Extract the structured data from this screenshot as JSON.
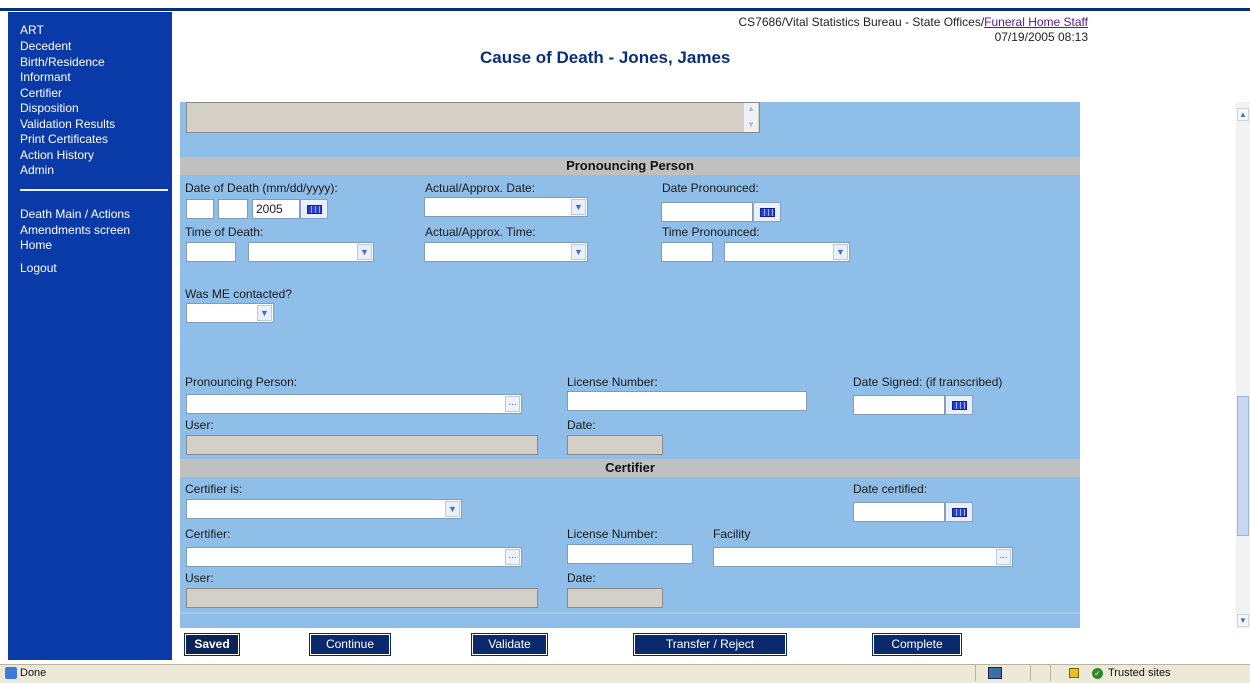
{
  "sidebar": {
    "items": [
      "ART",
      "Decedent",
      "Birth/Residence",
      "Informant",
      "Certifier",
      "Disposition",
      "Validation Results",
      "Print Certificates",
      "Action History",
      "Admin"
    ],
    "links": [
      "Death Main / Actions",
      "Amendments screen",
      "Home"
    ],
    "logout": "Logout"
  },
  "header": {
    "location": "CS7686/Vital Statistics Bureau - State Offices/",
    "role_link": "Funeral Home Staff",
    "timestamp": "07/19/2005 08:13",
    "title": "Cause of Death - Jones, James"
  },
  "pronouncing": {
    "section_title": "Pronouncing Person",
    "date_of_death_label": "Date of Death (mm/dd/yyyy):",
    "dod_year": "2005",
    "actual_approx_date_label": "Actual/Approx. Date:",
    "date_pronounced_label": "Date Pronounced:",
    "time_of_death_label": "Time of Death:",
    "actual_approx_time_label": "Actual/Approx. Time:",
    "time_pronounced_label": "Time Pronounced:",
    "me_contacted_label": "Was ME contacted?",
    "person_label": "Pronouncing Person:",
    "license_label": "License Number:",
    "date_signed_label": "Date Signed: (if transcribed)",
    "user_label": "User:",
    "date_label": "Date:"
  },
  "certifier": {
    "section_title": "Certifier",
    "certifier_is_label": "Certifier is:",
    "date_certified_label": "Date certified:",
    "certifier_label": "Certifier:",
    "license_label": "License Number:",
    "facility_label": "Facility",
    "user_label": "User:",
    "date_label": "Date:"
  },
  "buttons": {
    "saved": "Saved",
    "continue": "Continue",
    "validate": "Validate",
    "transfer": "Transfer / Reject",
    "complete": "Complete"
  },
  "statusbar": {
    "status": "Done",
    "zone": "Trusted sites"
  },
  "colors": {
    "sidebar": "#0a3aa8",
    "panel": "#8fbfe8",
    "section_bar": "#c0c0c0",
    "button": "#0b2a6e"
  }
}
